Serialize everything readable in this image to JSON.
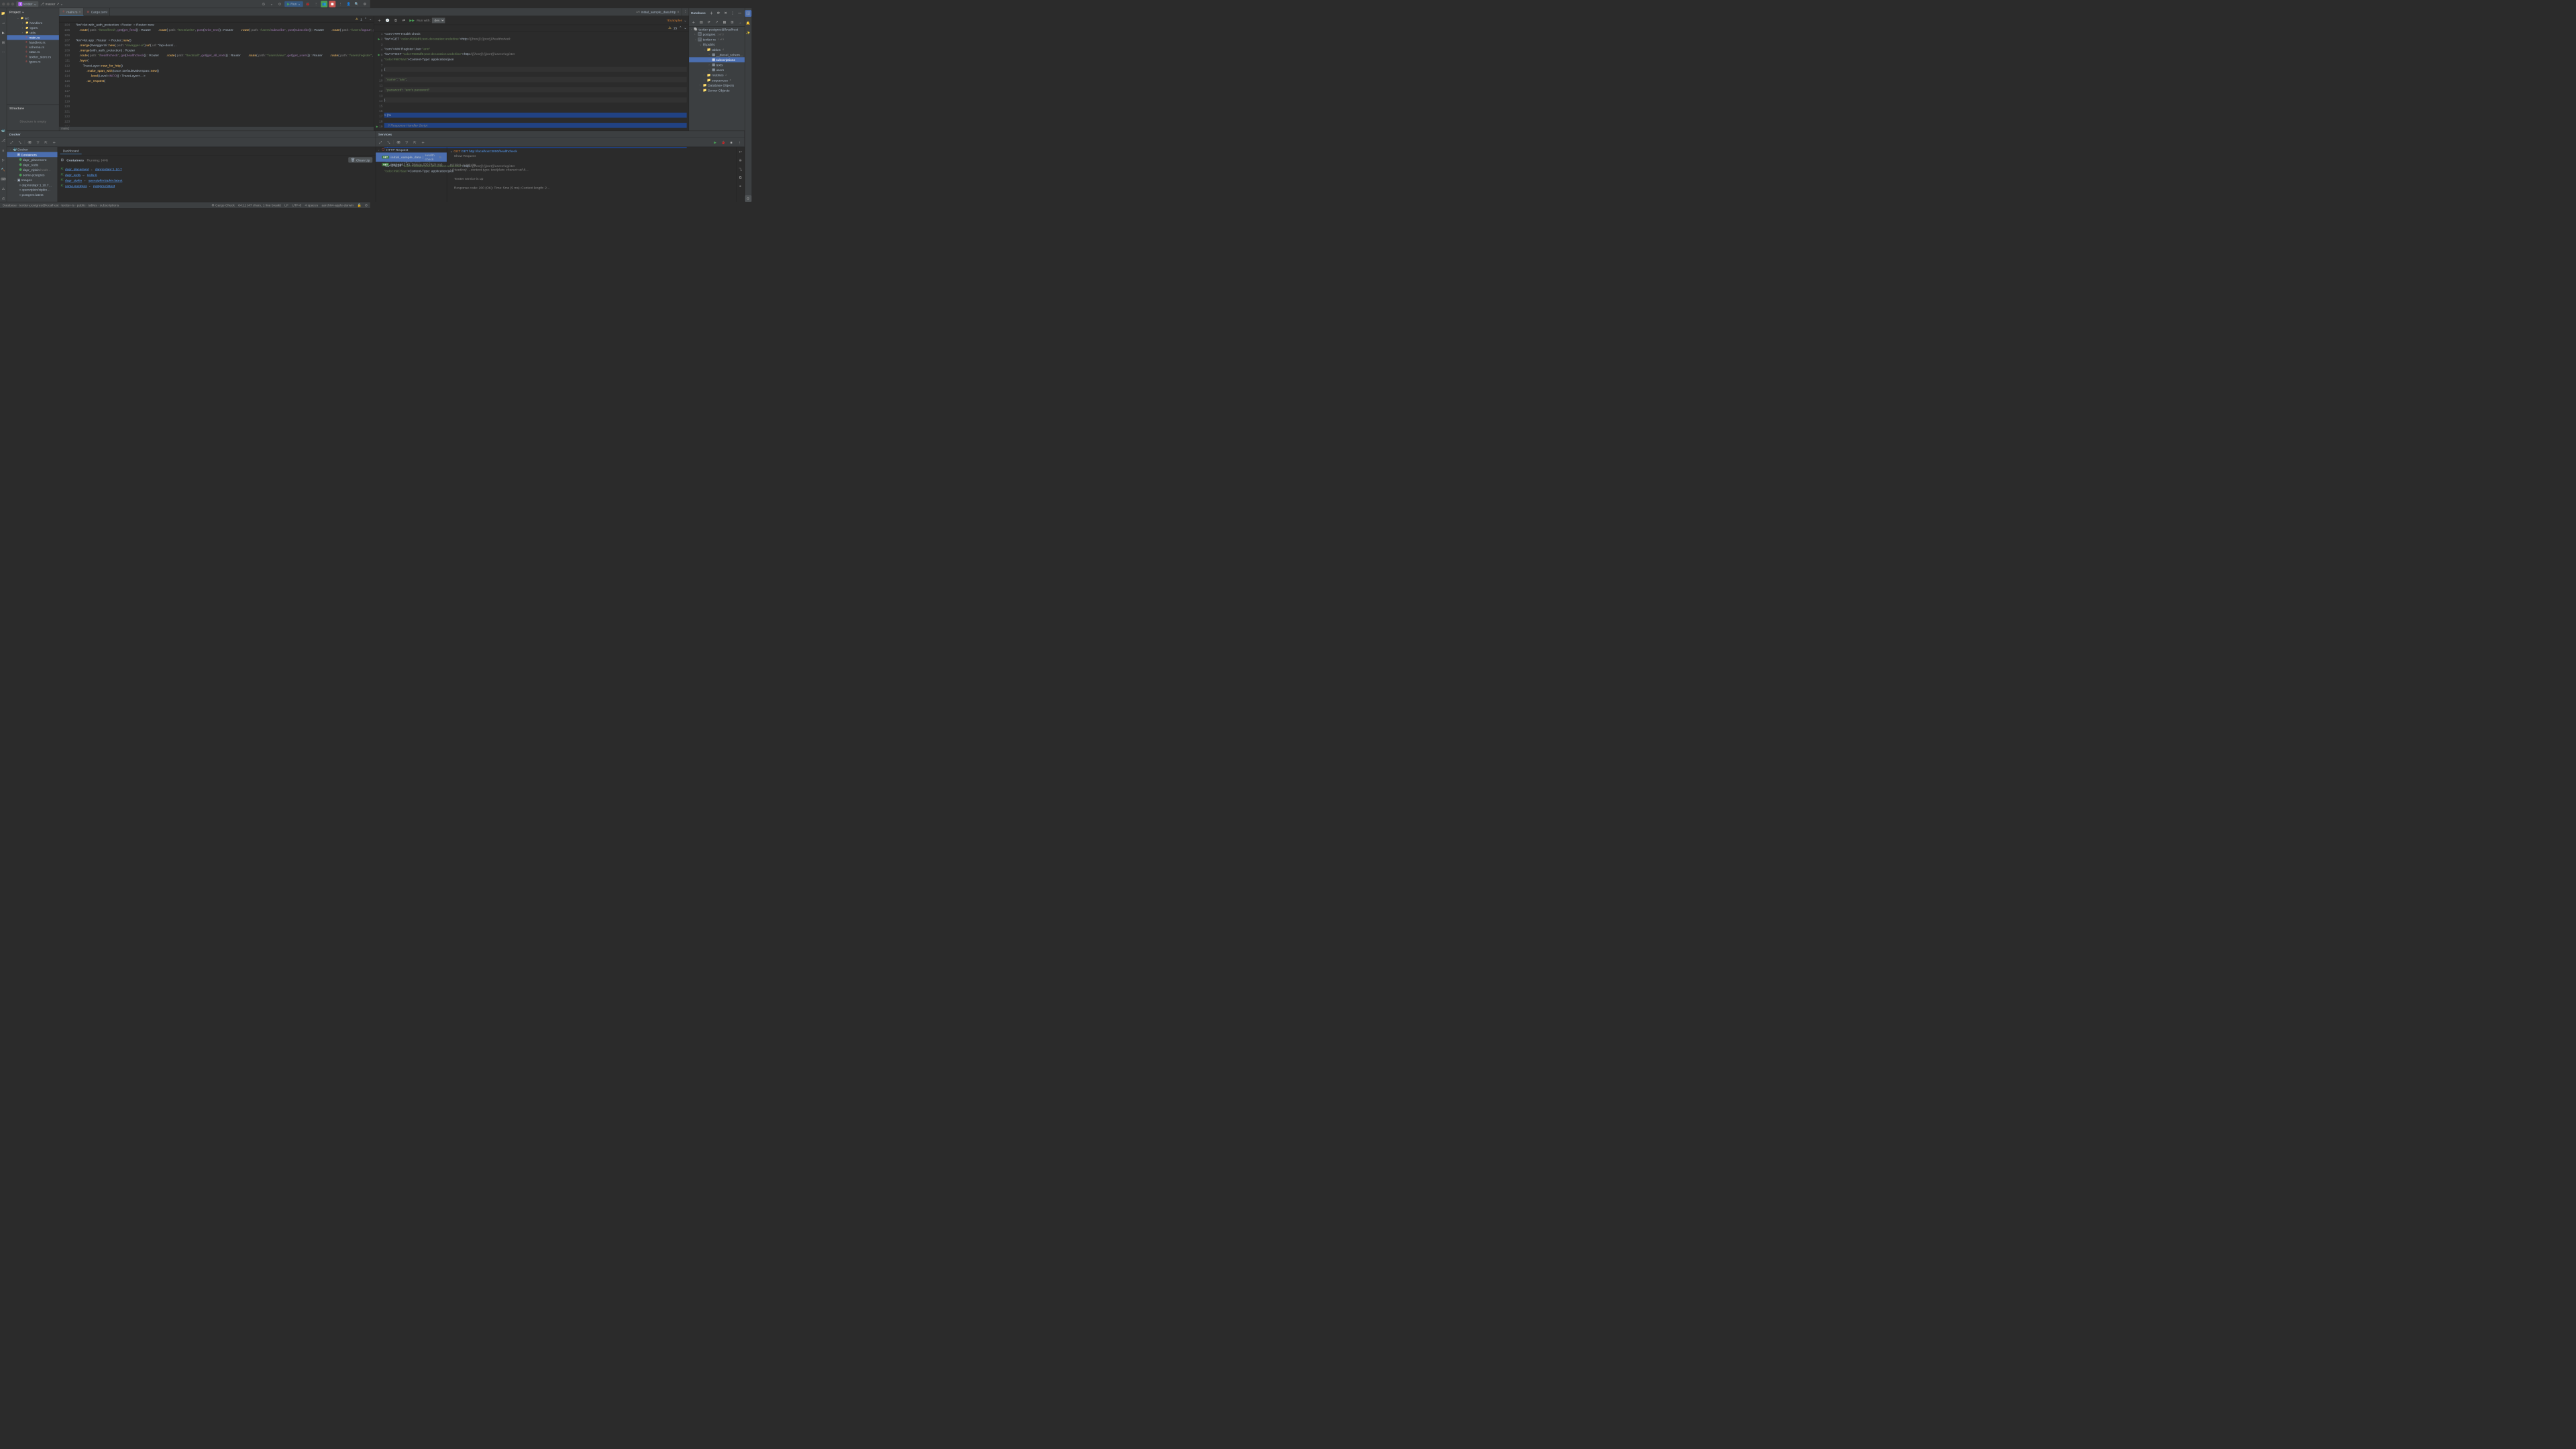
{
  "titlebar": {
    "project_initial": "t",
    "project_name": "textter",
    "branch": "master",
    "run_label": "Run"
  },
  "project_panel": {
    "title": "Project",
    "root": "src",
    "folders": [
      "handlers",
      "types",
      "utils"
    ],
    "files": [
      "main.rs",
      "handlers.rs",
      "schema.rs",
      "state.rs",
      "textter_store.rs",
      "types.rs"
    ],
    "selected": "main.rs"
  },
  "structure": {
    "title": "Structure",
    "empty_text": "Structure is empty"
  },
  "editor": {
    "tabs": [
      {
        "name": "main.rs",
        "active": true,
        "icon": "rust"
      },
      {
        "name": "Cargo.toml",
        "active": false,
        "icon": "cargo"
      }
    ],
    "warn_count": "1",
    "run_with_label": "Run with:",
    "run_with_value": "dev",
    "gutter_start": 104,
    "breadcrumb": "main()",
    "lines": [
      "    let with_auth_protection : Router<AppState>  = Router::new",
      "        .route( path: \"/texts/feed\", get(get_feed)) : Router<AppState, Body:…",
      "        .route( path: \"/texts/write\", post(write_text)) : Router<AppState, B…",
      "        .route( path: \"/users/subscribe\", post(subscribe)) : Router<AppState…",
      "        .route( path: \"/users/logout\", post(logout)) : Router<AppState, Body…",
      "        .layer(from_fn_with_state(shared_state.clone(), jwt_auth));",
      "",
      "    let app : Router  = Router::new()",
      "        .merge(SwaggerUi::new( path: \"/swagger-ui\").url( url: \"/api-docs/…",
      "        .merge(with_auth_protection) : Router<AppState, Body>",
      "        .route( path: \"/healthcheck\", get(healthcheck)) : Router<AppState, …",
      "        .route( path: \"/texts/all\", get(get_all_texts)) : Router<AppState, …",
      "        .route( path: \"/users/view\", get(get_users)) : Router<AppState, Bod…",
      "        .route( path: \"/users/register\", post(register_user)) : Router<Ap…",
      "        .route( path: \"/users/login\", post(login_user)) : Router<AppState, …",
      "        .fallback(fallback) : Router<AppState, Body>",
      "        .layer(",
      "            TraceLayer::new_for_http()",
      "                .make_span_with(trace::DefaultMakeSpan::new()",
      "                    .level(Level::INFO)) : TraceLayer<…>",
      "                .on_request("
    ]
  },
  "http_tab": {
    "name": "initial_sample_data.http",
    "warn_count": "15",
    "examples_label": "*Examples",
    "lines": [
      "### Health check",
      "GET http://{{host}}:{{port}}/healthcheck",
      "",
      "### Register User \"ann\"",
      "POST http://{{host}}:{{port}}/users/register",
      "Content-Type: application/json",
      "",
      "{",
      "  \"name\": \"ann\",",
      "  \"password\": \"ann's password\"",
      "}",
      "",
      "> {%",
      "    // Response Handler Script",
      "    client.global.set(\"ann_id\", response.body)",
      "%}",
      "",
      "### Register User \"mary\"",
      "POST http://{{host}}:{{port}}/users/register",
      "Content-Type: application/json",
      ""
    ]
  },
  "database": {
    "title": "Database",
    "datasource": "textter-postgres@localhost",
    "nodes": {
      "postgres": {
        "label": "postgres",
        "count": "1 of 3"
      },
      "textter_rs": {
        "label": "textter-rs",
        "count": "1 of 3"
      },
      "public": "public",
      "tables": {
        "label": "tables",
        "count": "4"
      },
      "table_list": [
        "__diesel_schem…",
        "subscriptions",
        "texts",
        "users"
      ],
      "selected_table": "subscriptions",
      "routines": {
        "label": "routines",
        "count": "2"
      },
      "sequences": {
        "label": "sequences",
        "count": "6"
      },
      "db_objects": "Database Objects",
      "server_objects": "Server Objects"
    }
  },
  "docker": {
    "title": "Docker",
    "dashboard_tab": "Dashboard",
    "containers_label": "Containers",
    "running_status": "Running: (4/4)",
    "clean_up": "Clean Up",
    "root": "Docker",
    "containers_node": "Containers",
    "containers": [
      {
        "name": "dapr_placement",
        "image": "daprio/dapr:1.10.7"
      },
      {
        "name": "dapr_redis",
        "image": "redis:6"
      },
      {
        "name": "dapr_zipkin",
        "image": "openzipkin/zipkin:latest",
        "status": "healt…"
      },
      {
        "name": "some-postgres",
        "image": "postgres:latest"
      }
    ],
    "images_node": "Images",
    "images": [
      "daprio/dapr:1.10.7…",
      "openzipkin/zipkin…",
      "postgres:latest"
    ]
  },
  "services": {
    "title": "Services",
    "http_node": "HTTP Request",
    "requests": [
      {
        "method": "GET",
        "name": "initial_sample_data",
        "detail": "Health check",
        "selected": true,
        "status": "S…"
      },
      {
        "method": "GET",
        "name": "rest-api",
        "detail": "#1",
        "status": "Status: 200 (419 ms)"
      }
    ],
    "output": {
      "req_line": "GET http://localhost:3000/healthcheck",
      "show_request": "Show Request",
      "resp_line": "HTTP/1.1 200 OK",
      "headers": "(Headers) …content-type: text/plain; charset=utf-8…",
      "body": "Textter service is up",
      "summary": "Response code: 200 (OK); Time: 5ms (5 ms); Content length: 2…"
    }
  },
  "statusbar": {
    "crumbs": [
      "Database",
      "textter-postgres@localhost",
      "textter-rs",
      "public",
      "tables",
      "subscriptions"
    ],
    "cargo": "Cargo Check",
    "position": "64:11 (47 chars, 1 line break)",
    "encoding_lf": "LF",
    "encoding": "UTF-8",
    "indent": "4 spaces",
    "arch": "aarch64-apple-darwin"
  }
}
